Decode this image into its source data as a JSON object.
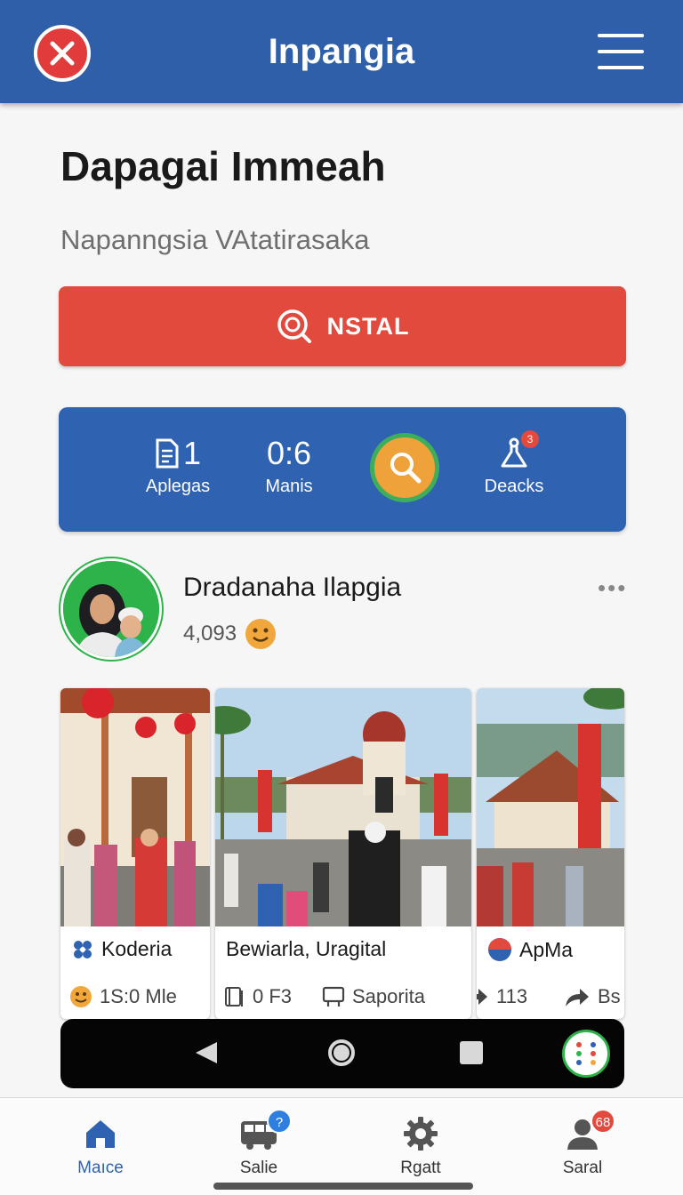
{
  "header": {
    "title": "Inpangia",
    "close_icon": "close-icon",
    "menu_icon": "hamburger-menu-icon"
  },
  "page": {
    "title": "Dapagai Immeah",
    "subtitle": "Napanngsia  VAtatirasaka"
  },
  "install_button": {
    "label": "NSTAL",
    "icon": "search-icon",
    "color": "#e14a3c"
  },
  "stats": [
    {
      "value": "1",
      "label": "Aplegas",
      "icon": "document-icon"
    },
    {
      "value": "0:6",
      "label": "Manis"
    },
    {
      "value": "",
      "label": "Deacks",
      "icon": "flask-icon",
      "badge": "3"
    }
  ],
  "stats_search_icon": "search-icon",
  "profile": {
    "name": "Dradanaha Ilapgia",
    "count": "4,093",
    "emoji_icon": "smiley-icon"
  },
  "cards": [
    {
      "caption": "Koderia",
      "meta": "1S:0 Mle"
    },
    {
      "caption": "Bewiarla, Uragital",
      "meta": "0 F3",
      "meta2": "Saporita"
    },
    {
      "caption": "ApMa",
      "meta": "113",
      "meta2": "Bs"
    }
  ],
  "tabs": [
    {
      "label": "Maıce",
      "icon": "home-icon",
      "active": true
    },
    {
      "label": "Salie",
      "icon": "bus-icon",
      "badge": "?"
    },
    {
      "label": "Rgatt",
      "icon": "gear-icon"
    },
    {
      "label": "Saral",
      "icon": "user-icon",
      "badge": "68"
    }
  ],
  "colors": {
    "header": "#2f5fa8",
    "stats_panel": "#2f62b0",
    "accent_green": "#2eb34a",
    "badge_blue": "#2f7fe0",
    "badge_red": "#e14a3c"
  }
}
